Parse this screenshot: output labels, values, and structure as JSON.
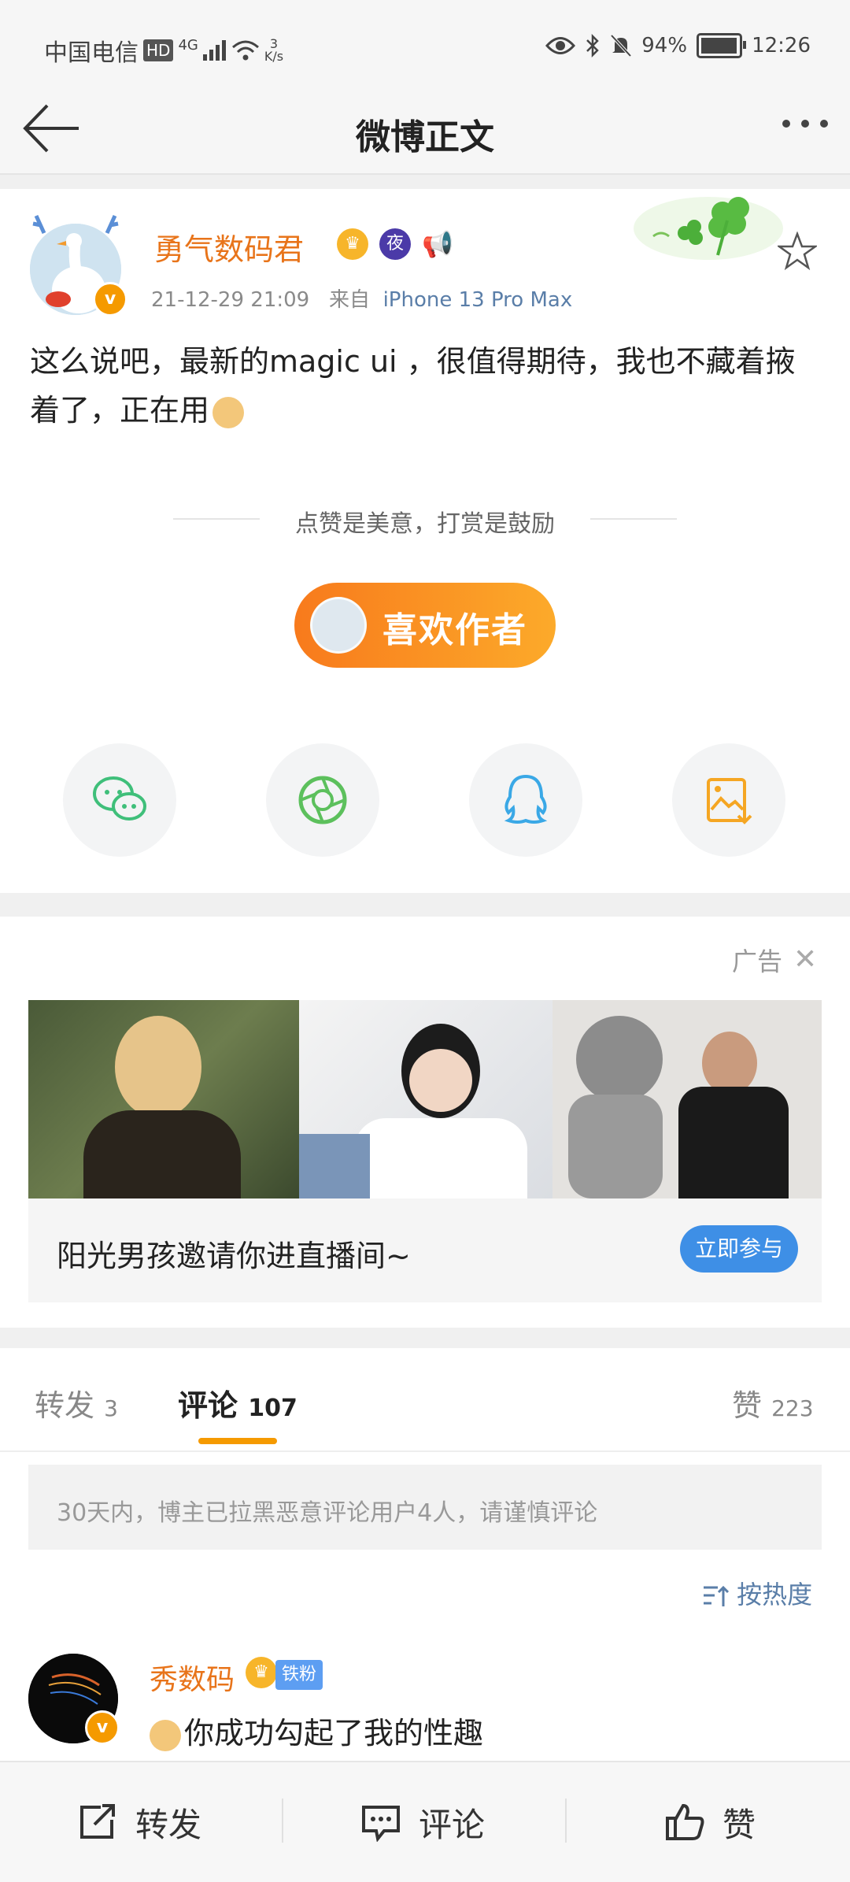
{
  "status_bar": {
    "carrier": "中国电信",
    "hd": "HD",
    "network": "4G",
    "speed_value": "3",
    "speed_unit": "K/s",
    "battery": "94%",
    "time": "12:26"
  },
  "nav": {
    "title": "微博正文"
  },
  "post": {
    "author": "勇气数码君",
    "badge_night": "夜",
    "timestamp": "21-12-29 21:09",
    "source_prefix": "来自",
    "source": "iPhone 13 Pro Max",
    "body": "这么说吧，最新的magic ui ，很值得期待，我也不藏着掖着了，正在用",
    "reward_note": "点赞是美意，打赏是鼓励",
    "like_author_label": "喜欢作者"
  },
  "share": {
    "items": [
      "wechat-icon",
      "moments-icon",
      "qq-icon",
      "save-image-icon"
    ]
  },
  "ad": {
    "label": "广告",
    "caption": "阳光男孩邀请你进直播间~",
    "cta": "立即参与"
  },
  "tabs": {
    "repost_label": "转发",
    "repost_count": "3",
    "comments_label": "评论",
    "comments_count": "107",
    "likes_label": "赞",
    "likes_count": "223"
  },
  "notice": "30天内，博主已拉黑恶意评论用户4人，请谨慎评论",
  "sort_label": "按热度",
  "comment": {
    "author": "秀数码",
    "fan_badge": "铁粉",
    "text": "你成功勾起了我的性趣"
  },
  "bottom_bar": {
    "repost": "转发",
    "comment": "评论",
    "like": "赞"
  },
  "colors": {
    "accent_orange": "#e8741a",
    "link_blue": "#5a7ea8",
    "cta_blue": "#3e8fe6",
    "tab_indicator": "#f59a00"
  }
}
